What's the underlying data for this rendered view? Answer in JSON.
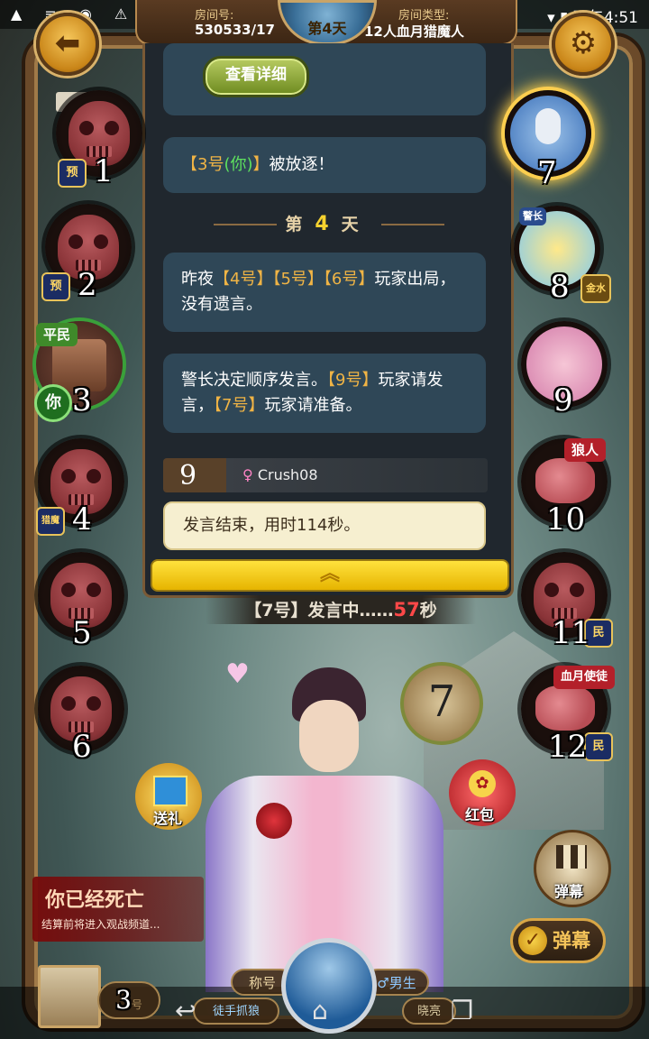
{
  "status_bar": {
    "left_icons": "▲ ≡ ◉ ⚠ ⬇ ▣ ⏱ ▲",
    "right": "▾ ▮ 下午4:51"
  },
  "header": {
    "room_no_label": "房间号:",
    "room_no": "530533/17",
    "day_badge": "第4天",
    "room_type_label": "房间类型:",
    "room_type": "12人血月猎魔人"
  },
  "buttons": {
    "back_glyph": "⬅",
    "settings_glyph": "⚙",
    "view_details": "查看详细",
    "red_packet": "红包",
    "send_gift": "送礼",
    "danmaku_toggle": "弹幕",
    "danmaku_send": "弹幕"
  },
  "chat": {
    "msg_expelled": {
      "a": "【3号",
      "b": "(你)",
      "c": "】",
      "d": "被放逐！"
    },
    "day_divider": {
      "pre": "第",
      "num": "4",
      "post": "天"
    },
    "msg_night": {
      "p1": "昨夜",
      "h1": "【4号】",
      "h2": "【5号】",
      "h3": "【6号】",
      "p2": "玩家出局，没有遗言。"
    },
    "msg_order": {
      "p1": "警长决定顺序发言。",
      "h1": "【9号】",
      "p2": "玩家请发言，",
      "h2": "【7号】",
      "p3": "玩家请准备。"
    },
    "speaker": {
      "num": "9",
      "gender": "♀",
      "name": "Crush08"
    },
    "system": "发言结束，用时114秒。",
    "scroll_glyph": "︽"
  },
  "timer": {
    "pre": "【7号】发言中……",
    "seconds": "57",
    "unit": "秒"
  },
  "seats_left": [
    {
      "num": "1",
      "badge": "预",
      "state": "dead"
    },
    {
      "num": "2",
      "badge": "预",
      "state": "dead"
    },
    {
      "num": "3",
      "flag": "平民",
      "you": "你",
      "state": "self"
    },
    {
      "num": "4",
      "badge": "猎魔",
      "state": "dead"
    },
    {
      "num": "5",
      "state": "dead"
    },
    {
      "num": "6",
      "state": "dead"
    }
  ],
  "seats_right": [
    {
      "num": "7",
      "state": "speaking"
    },
    {
      "num": "8",
      "flag": "警长",
      "badge": "金水",
      "state": "alive"
    },
    {
      "num": "9",
      "state": "alive"
    },
    {
      "num": "10",
      "flag": "狼人",
      "state": "dead"
    },
    {
      "num": "11",
      "badge": "民",
      "state": "dead"
    },
    {
      "num": "12",
      "flag": "血月使徒",
      "badge": "民",
      "state": "dead"
    }
  ],
  "stage": {
    "speaker_bubble": "7"
  },
  "dead_notice": {
    "title": "你已经死亡",
    "subtitle": "结算前将进入观战频道..."
  },
  "bottom": {
    "self_num": "3",
    "self_suffix": "号",
    "title_pill": "称号",
    "gender_pill": "♂男生",
    "tag_left": "徒手抓狼",
    "tag_right": "晓亮",
    "nav_back": "↩",
    "nav_home": "⌂",
    "nav_recent": "❐"
  },
  "colors": {
    "highlight": "#f0b445",
    "you_green": "#5ee05e",
    "timer_red": "#ff4848",
    "wolf_flag": "#b3202a",
    "citizen_flag": "#3f8a2a"
  }
}
